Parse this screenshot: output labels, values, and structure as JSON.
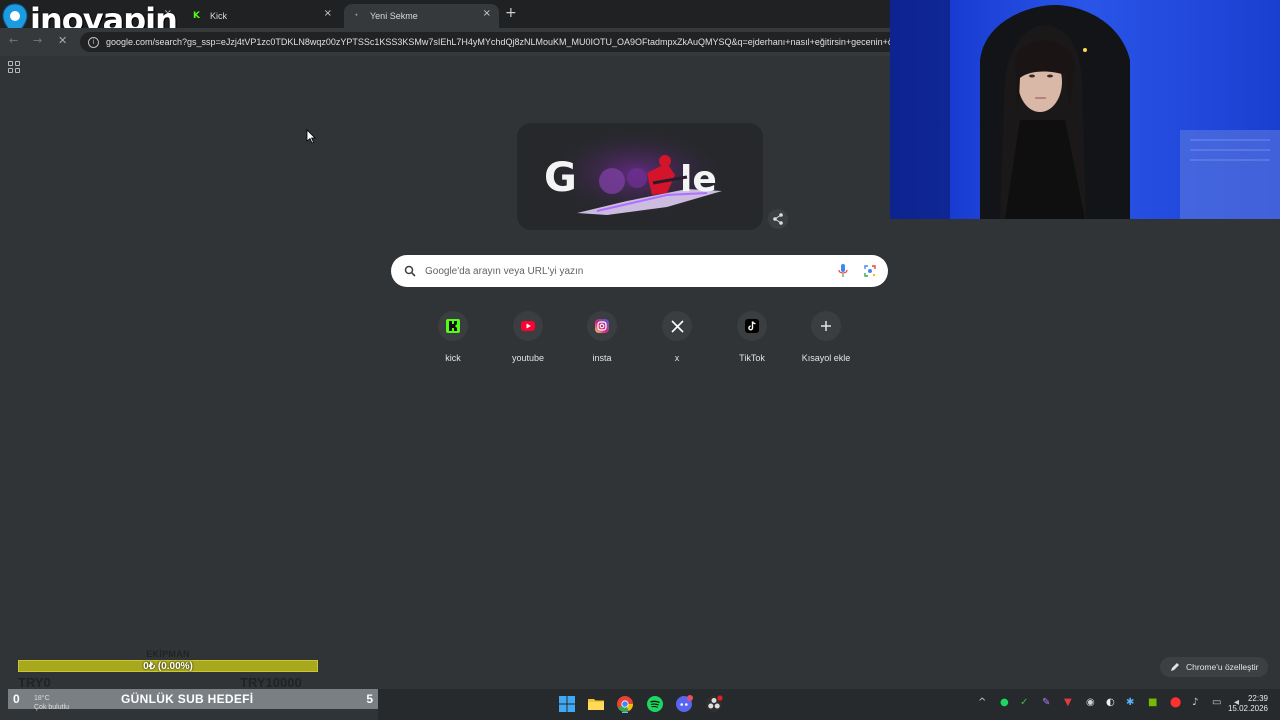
{
  "overlay": {
    "brand": "inovapin"
  },
  "browser": {
    "tabs": [
      {
        "label": "",
        "close": "×"
      },
      {
        "label": "Kick",
        "close": "×"
      },
      {
        "label": "Yeni Sekme",
        "close": "×"
      }
    ],
    "new_tab": "+",
    "url": "google.com/search?gs_ssp=eJzj4tVP1zc0TDKLN8wqz00zYPTSSc1KSS3KSMw7sIEhL7H4yMYchdQj8zNLMouKM_MU0IOTU_OA9OFtadmpxZkAuQMYSQ&q=ejderhanı+nasıl+eğitirsin+gecenin+ö"
  },
  "new_tab_page": {
    "search_placeholder": "Google'da arayın veya URL'yi yazın",
    "shortcuts": [
      {
        "label": "kick",
        "icon": "kick-icon"
      },
      {
        "label": "youtube",
        "icon": "youtube-icon"
      },
      {
        "label": "insta",
        "icon": "instagram-icon"
      },
      {
        "label": "x",
        "icon": "x-icon"
      },
      {
        "label": "TikTok",
        "icon": "tiktok-icon"
      },
      {
        "label": "Kısayol ekle",
        "icon": "plus-icon"
      }
    ],
    "customize_label": "Chrome'u özelleştir"
  },
  "stream_widget": {
    "goal_title": "EKİPMAN",
    "goal_progress": "0₺ (0.00%)",
    "goal_progress_fraction": 0.0,
    "goal_min": "TRY0",
    "goal_max": "TRY10000",
    "sub_current": "0",
    "sub_label": "GÜNLÜK SUB HEDEFİ",
    "sub_target": "5",
    "weather_temp": "18°C",
    "weather_desc": "Çok bulutlu"
  },
  "taskbar": {
    "time": "22:39",
    "date": "15.02.2026"
  },
  "colors": {
    "page_bg": "#303436",
    "tabstrip_bg": "#1f2123",
    "goal_bar": "#a8a81e",
    "kick_green": "#53fc18"
  }
}
